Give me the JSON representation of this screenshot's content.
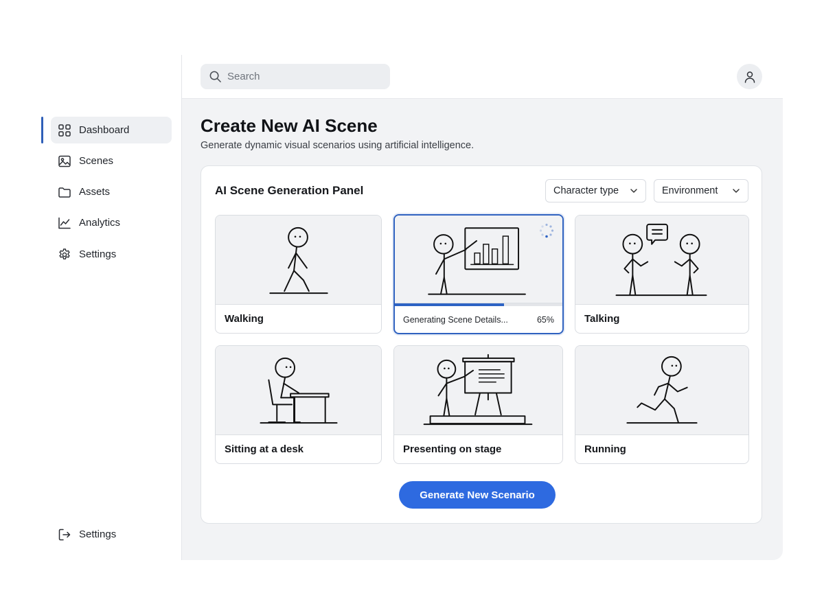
{
  "sidebar": {
    "items": [
      {
        "label": "Dashboard",
        "icon": "grid-icon",
        "active": true
      },
      {
        "label": "Scenes",
        "icon": "image-icon"
      },
      {
        "label": "Assets",
        "icon": "folder-icon"
      },
      {
        "label": "Analytics",
        "icon": "line-chart-icon"
      },
      {
        "label": "Settings",
        "icon": "gear-icon"
      }
    ],
    "footer": {
      "label": "Settings",
      "icon": "logout-icon"
    }
  },
  "topbar": {
    "search_placeholder": "Search"
  },
  "page": {
    "title": "Create New AI Scene",
    "subtitle": "Generate dynamic visual scenarios using artificial intelligence."
  },
  "panel": {
    "title": "AI Scene Generation Panel",
    "filters": {
      "character_type": "Character type",
      "environment": "Environment"
    },
    "cards": [
      {
        "label": "Walking"
      },
      {
        "label": "Generating Scene Details...",
        "progress_text": "65%",
        "progress": 0.65,
        "state": "generating"
      },
      {
        "label": "Talking"
      },
      {
        "label": "Sitting at a desk"
      },
      {
        "label": "Presenting on stage"
      },
      {
        "label": "Running"
      }
    ],
    "generate_button": "Generate New Scenario"
  },
  "colors": {
    "accent": "#2e6ae0",
    "active_bar": "#2f5fb8",
    "progress": "#2d63c4"
  }
}
